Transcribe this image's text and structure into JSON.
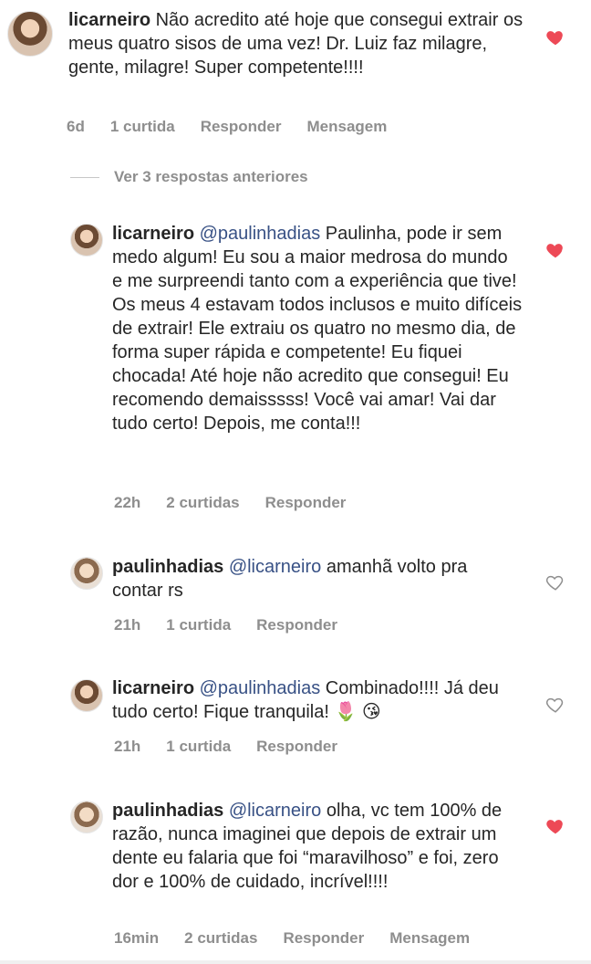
{
  "colors": {
    "heart_filled": "#ed4956",
    "muted": "#8e8e8e",
    "mention": "#385185",
    "text": "#262626"
  },
  "comments": [
    {
      "user": "licarneiro",
      "mention": "",
      "text": "Não acredito até hoje que consegui extrair os meus quatro sisos de uma vez! Dr. Luiz faz milagre, gente, milagre! Super competente!!!!",
      "time": "6d",
      "likes": "1 curtida",
      "reply": "Responder",
      "message": "Mensagem",
      "liked": true
    },
    {
      "user": "licarneiro",
      "mention": "@paulinhadias",
      "text": " Paulinha, pode ir sem medo algum! Eu sou a maior medrosa do mundo e me surpreendi tanto com a experiência que tive! Os meus 4 estavam todos inclusos e muito difíceis de extrair! Ele extraiu os quatro no mesmo dia, de forma super rápida e competente! Eu fiquei chocada! Até hoje não acredito que consegui! Eu recomendo demaisssss! Você vai amar! Vai dar tudo certo! Depois, me conta!!!",
      "time": "22h",
      "likes": "2 curtidas",
      "reply": "Responder",
      "liked": true
    },
    {
      "user": "paulinhadias",
      "mention": "@licarneiro",
      "text": " amanhã volto pra contar rs",
      "time": "21h",
      "likes": "1 curtida",
      "reply": "Responder",
      "liked": false
    },
    {
      "user": "licarneiro",
      "mention": "@paulinhadias",
      "text": " Combinado!!!! Já deu tudo certo! Fique tranquila! 🌷 😘",
      "time": "21h",
      "likes": "1 curtida",
      "reply": "Responder",
      "liked": false
    },
    {
      "user": "paulinhadias",
      "mention": "@licarneiro",
      "text": " olha, vc tem 100% de razão, nunca imaginei que depois de extrair um dente eu falaria que foi “maravilhoso” e foi, zero dor e 100% de cuidado, incrível!!!!",
      "time": "16min",
      "likes": "2 curtidas",
      "reply": "Responder",
      "message": "Mensagem",
      "liked": true
    }
  ],
  "view_replies": "Ver 3 respostas anteriores"
}
